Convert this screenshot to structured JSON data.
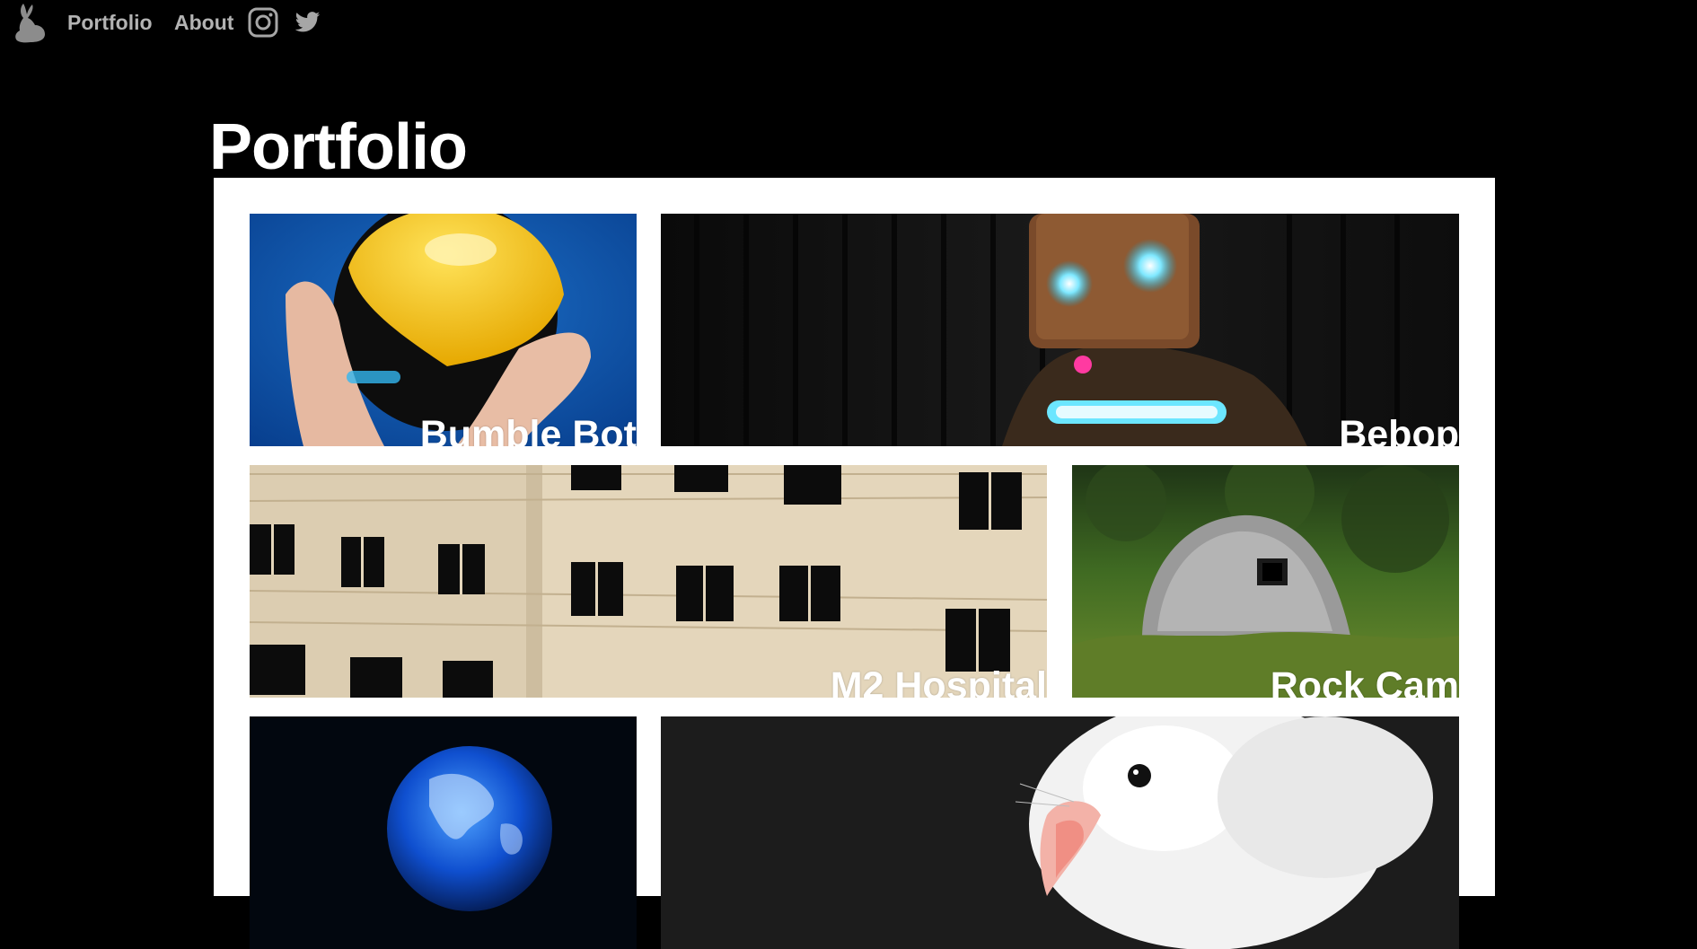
{
  "nav": {
    "logo_icon": "rabbit-logo-icon",
    "links": [
      {
        "label": "Portfolio"
      },
      {
        "label": "About"
      }
    ],
    "social_icons": [
      "instagram-icon",
      "twitter-icon"
    ],
    "link_color": "#b3b3b3"
  },
  "main": {
    "title": "Portfolio"
  },
  "projects": [
    {
      "label": "Bumble Bot"
    },
    {
      "label": "Bebop"
    },
    {
      "label": "M2 Hospital"
    },
    {
      "label": "Rock Cam"
    },
    {
      "label": ""
    },
    {
      "label": ""
    }
  ],
  "colors": {
    "background": "#000000",
    "panel": "#ffffff",
    "text": "#ffffff"
  }
}
